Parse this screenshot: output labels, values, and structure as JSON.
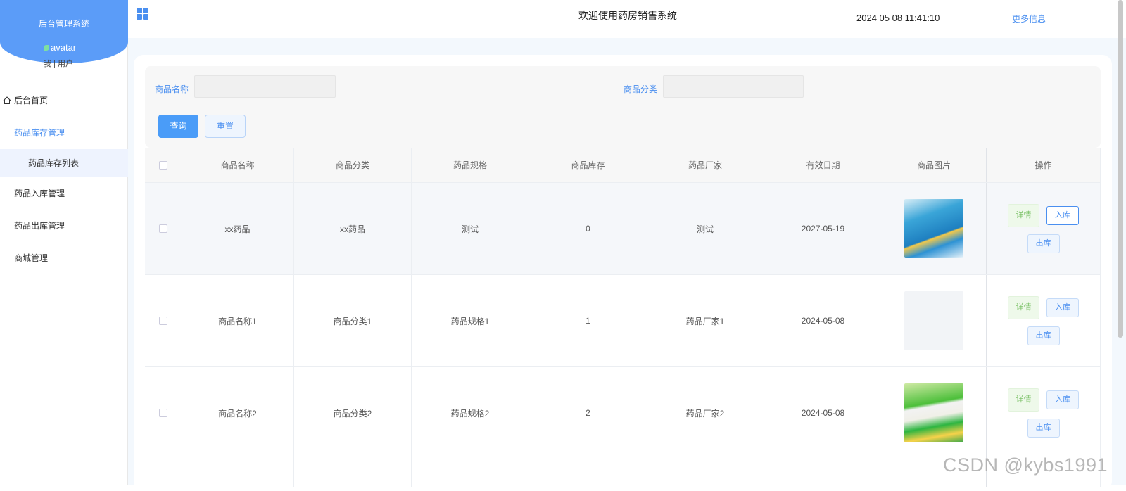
{
  "sidebar": {
    "brand_title": "后台管理系统",
    "avatar_text": "avatar",
    "role_text": "我 | 用户",
    "items": [
      {
        "label": "后台首页"
      },
      {
        "label": "药品库存管理"
      },
      {
        "label": "药品库存列表"
      },
      {
        "label": "药品入库管理"
      },
      {
        "label": "药品出库管理"
      },
      {
        "label": "商城管理"
      }
    ]
  },
  "header": {
    "title": "欢迎使用药房销售系统",
    "datetime": "2024 05 08 11:41:10",
    "more_info": "更多信息"
  },
  "search": {
    "name_label": "商品名称",
    "category_label": "商品分类",
    "query_button": "查询",
    "reset_button": "重置"
  },
  "table": {
    "columns": [
      "商品名称",
      "商品分类",
      "药品规格",
      "商品库存",
      "药品厂家",
      "有效日期",
      "商品图片",
      "操作"
    ],
    "rows": [
      {
        "name": "xx药品",
        "category": "xx药品",
        "spec": "测试",
        "stock": "0",
        "maker": "测试",
        "expiry": "2027-05-19",
        "image": "blue-medicine-box"
      },
      {
        "name": "商品名称1",
        "category": "商品分类1",
        "spec": "药品规格1",
        "stock": "1",
        "maker": "药品厂家1",
        "expiry": "2024-05-08",
        "image": "empty"
      },
      {
        "name": "商品名称2",
        "category": "商品分类2",
        "spec": "药品规格2",
        "stock": "2",
        "maker": "药品厂家2",
        "expiry": "2024-05-08",
        "image": "green-medicine-box"
      }
    ],
    "actions": {
      "detail": "详情",
      "in": "入库",
      "out": "出库"
    }
  },
  "watermark": "CSDN @kybs1991",
  "colors": {
    "accent": "#4a8ff0",
    "brand": "#5b9cf8",
    "detail_green": "#7fc36b"
  }
}
